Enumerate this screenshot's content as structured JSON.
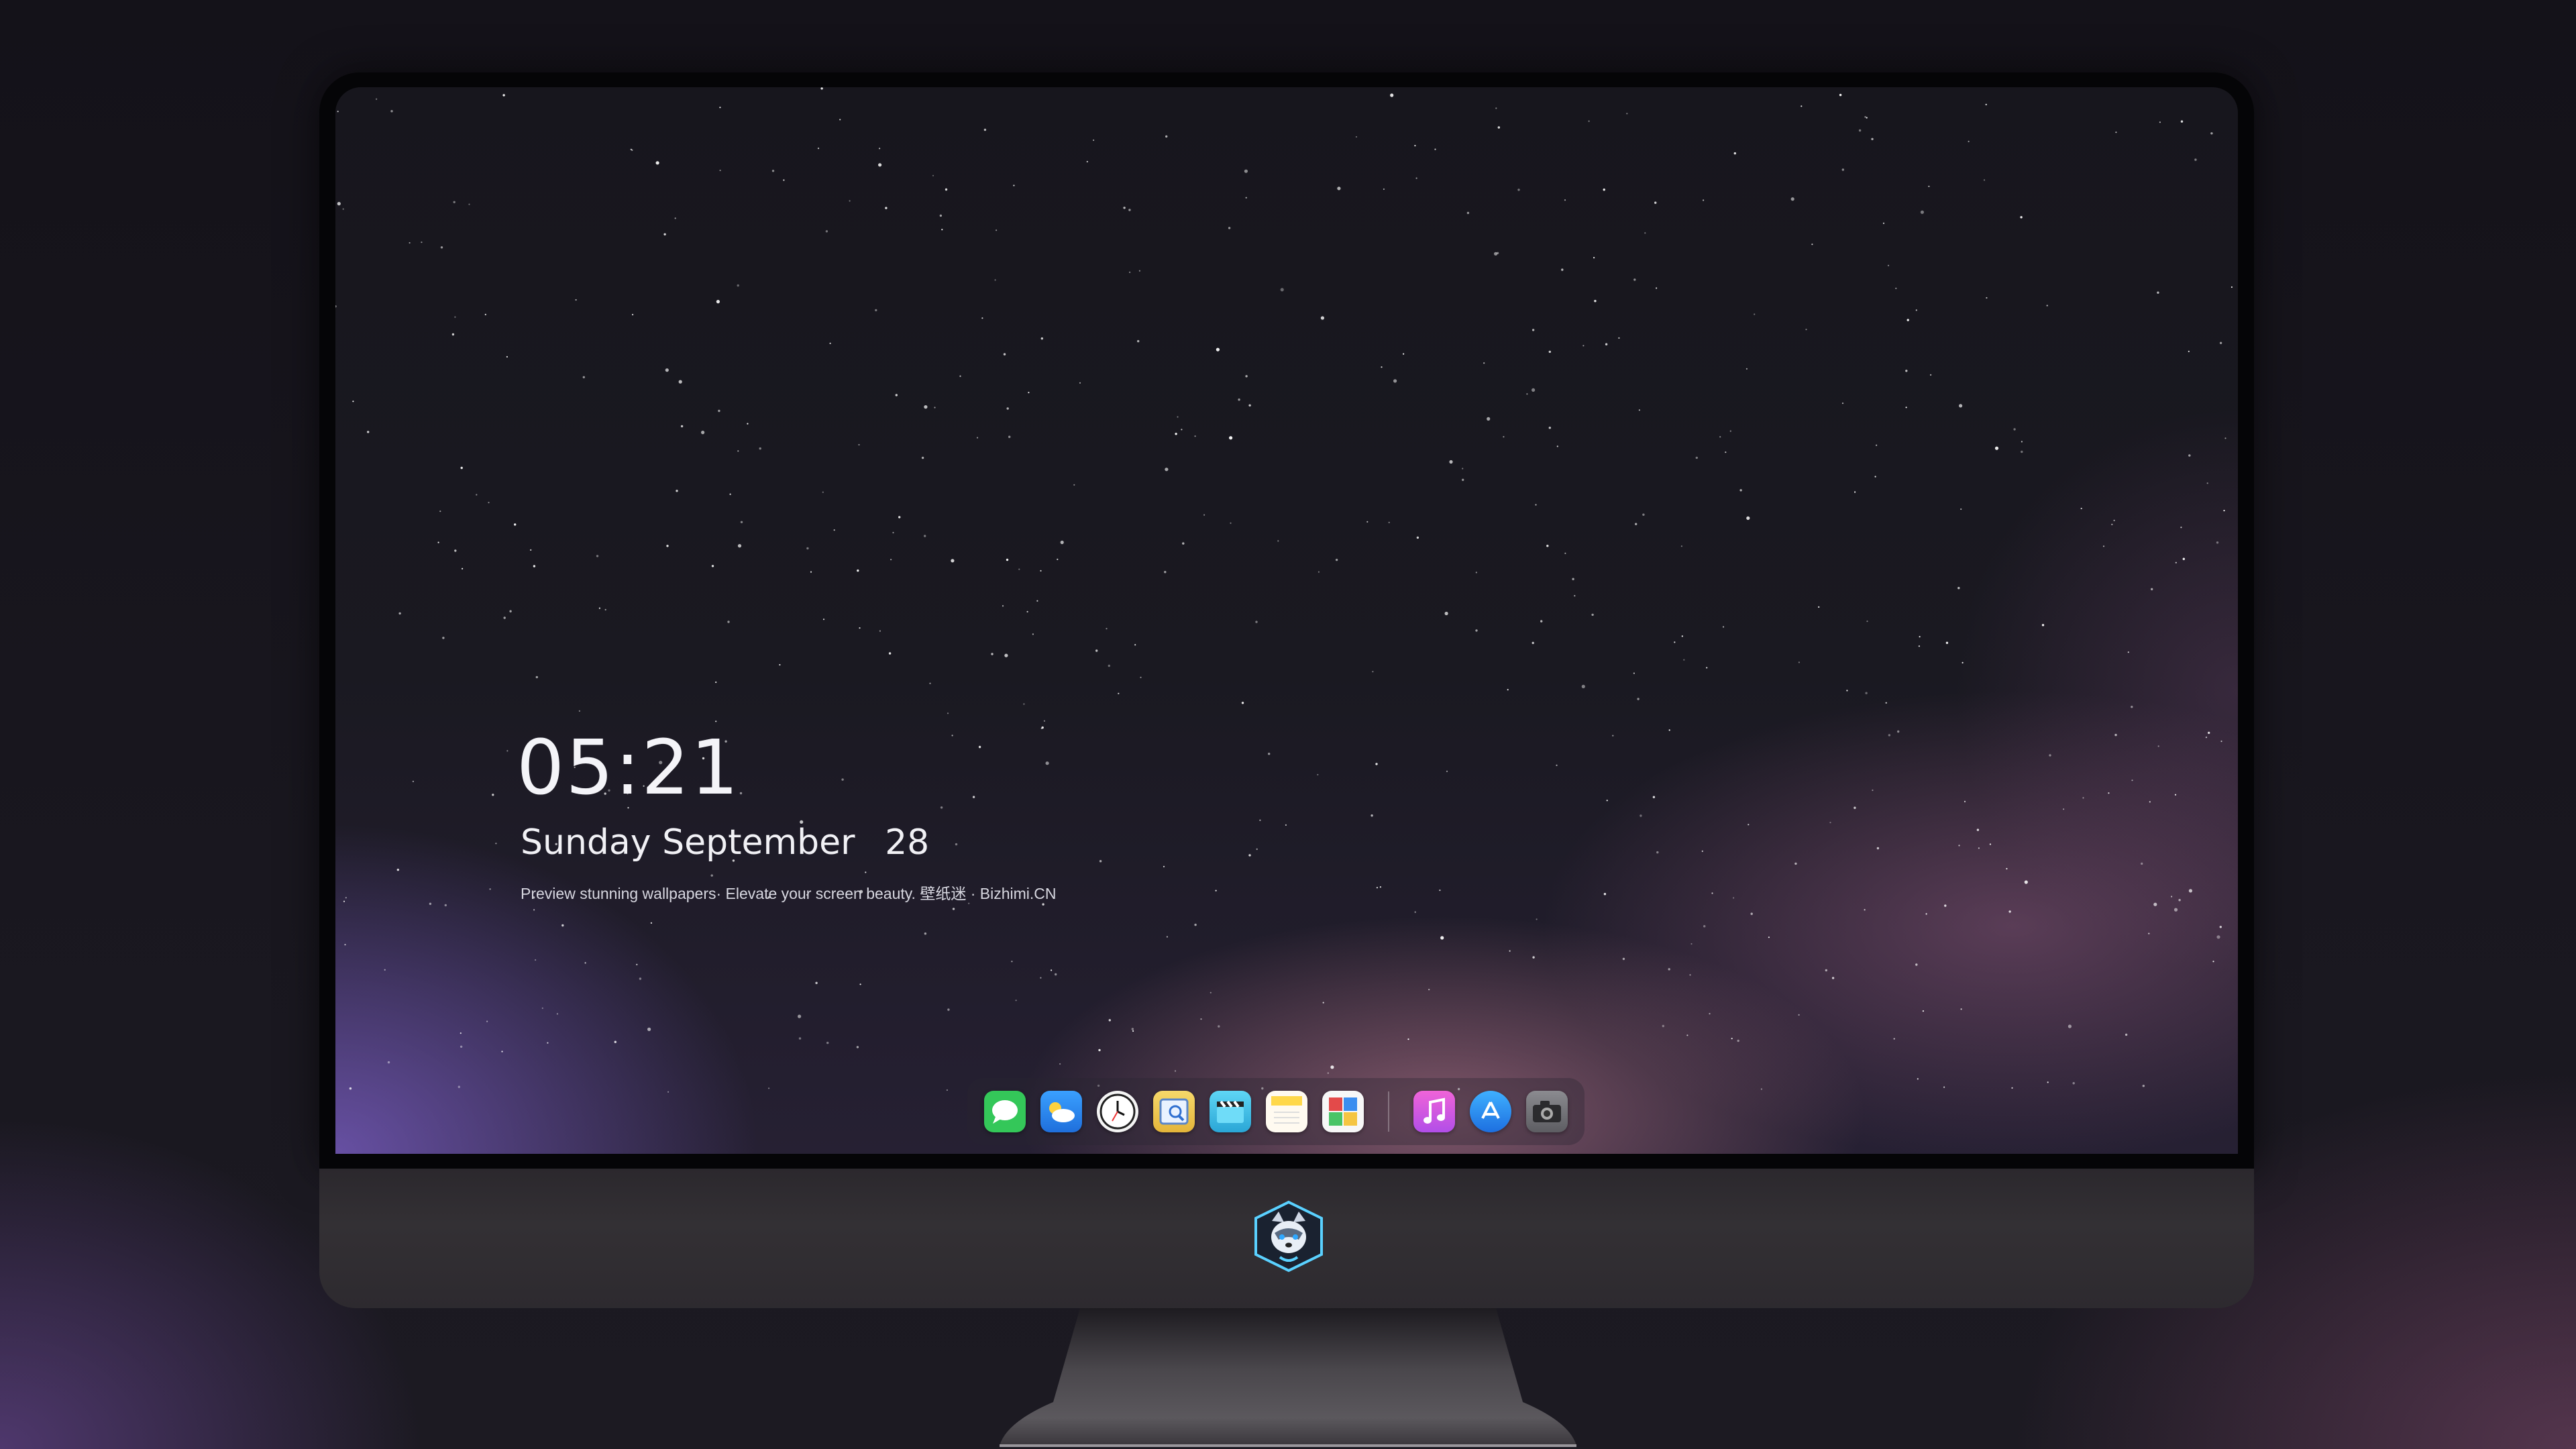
{
  "lock_screen": {
    "time": "05:21",
    "weekday": "Sunday",
    "month": "September",
    "day": "28",
    "tagline": "Preview stunning wallpapers· Elevate your screen beauty. 壁纸迷 · Bizhimi.CN"
  },
  "dock": {
    "items": [
      {
        "name": "messages",
        "icon": "speech-bubble-icon",
        "color": "#34c759"
      },
      {
        "name": "weather",
        "icon": "cloud-icon",
        "color": "#2f8ef0"
      },
      {
        "name": "clock",
        "icon": "clock-icon",
        "color": "#ffffff"
      },
      {
        "name": "preview",
        "icon": "preview-icon",
        "color": "#e8c34c"
      },
      {
        "name": "clips",
        "icon": "clapperboard-icon",
        "color": "#49c6ea"
      },
      {
        "name": "notes",
        "icon": "notes-icon",
        "color": "#ffd84a"
      },
      {
        "name": "photo-booth",
        "icon": "photo-grid-icon",
        "color": "#e34a4a"
      },
      {
        "name": "music",
        "icon": "music-note-icon",
        "color": "#d65cf0"
      },
      {
        "name": "app-store",
        "icon": "app-store-icon",
        "color": "#2f8ef0"
      },
      {
        "name": "camera",
        "icon": "camera-icon",
        "color": "#7a7a7e"
      }
    ]
  },
  "branding": {
    "chin_logo": "husky-mascot-logo"
  }
}
